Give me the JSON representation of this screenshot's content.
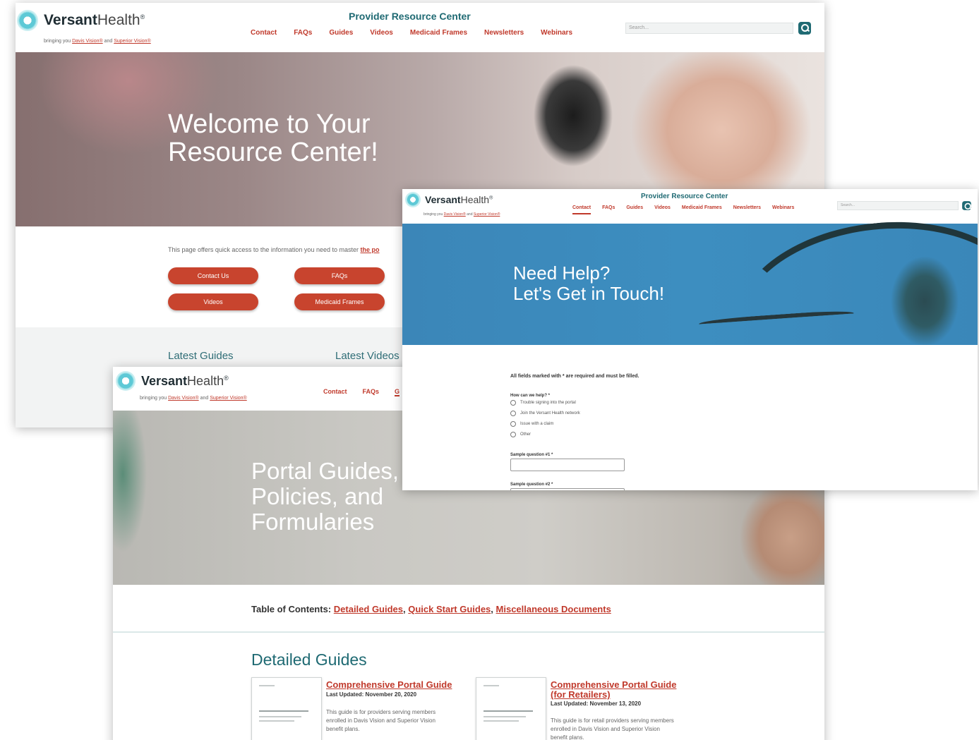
{
  "brand": {
    "logo_bold": "Versant",
    "logo_light": "Health",
    "registered": "®",
    "tagline_prefix": "bringing you ",
    "tagline_link1": "Davis Vision®",
    "tagline_mid": " and ",
    "tagline_link2": "Superior Vision®",
    "site_title": "Provider Resource Center"
  },
  "nav": [
    "Contact",
    "FAQs",
    "Guides",
    "Videos",
    "Medicaid Frames",
    "Newsletters",
    "Webinars"
  ],
  "search": {
    "placeholder": "Search..."
  },
  "home": {
    "hero_title": "Welcome to Your\nResource Center!",
    "intro_text": "This page offers quick access to the information you need to master ",
    "intro_link": "the po",
    "buttons": [
      "Contact Us",
      "FAQs",
      "Videos",
      "Medicaid Frames"
    ],
    "latest_guides": "Latest Guides",
    "latest_videos": "Latest Videos"
  },
  "guides_page": {
    "nav_visible": [
      "Contact",
      "FAQs",
      "G"
    ],
    "hero_title": "Portal Guides,\nPolicies, and\nFormularies",
    "toc_label": "Table of Contents: ",
    "toc_links": [
      "Detailed Guides",
      "Quick Start Guides",
      "Miscellaneous Documents"
    ],
    "section_title": "Detailed Guides",
    "guides": [
      {
        "title": "Comprehensive Portal Guide",
        "updated": "Last Updated: November 20, 2020",
        "description": "This guide is for providers serving members enrolled in Davis Vision and Superior Vision benefit plans."
      },
      {
        "title": "Comprehensive Portal Guide\n(for Retailers)",
        "updated": "Last Updated: November 13, 2020",
        "description": "This guide is for retail providers serving members enrolled in Davis Vision and Superior Vision benefit plans."
      }
    ]
  },
  "contact_page": {
    "hero_title": "Need Help?\nLet's Get in Touch!",
    "required_note": "All fields marked with * are required and must be filled.",
    "question_main": "How can we help? *",
    "options": [
      "Trouble signing into the portal",
      "Join the Versant Health network",
      "Issue with a claim",
      "Other"
    ],
    "sample_q1": "Sample question #1 *",
    "sample_q2": "Sample question #2 *"
  },
  "colors": {
    "accent_red": "#c0392b",
    "teal": "#1f6a73",
    "pill_red": "#c8442e",
    "hero_blue": "#3b86b8"
  },
  "icons": [
    "logo-mark-icon",
    "search-icon",
    "radio-icon"
  ]
}
